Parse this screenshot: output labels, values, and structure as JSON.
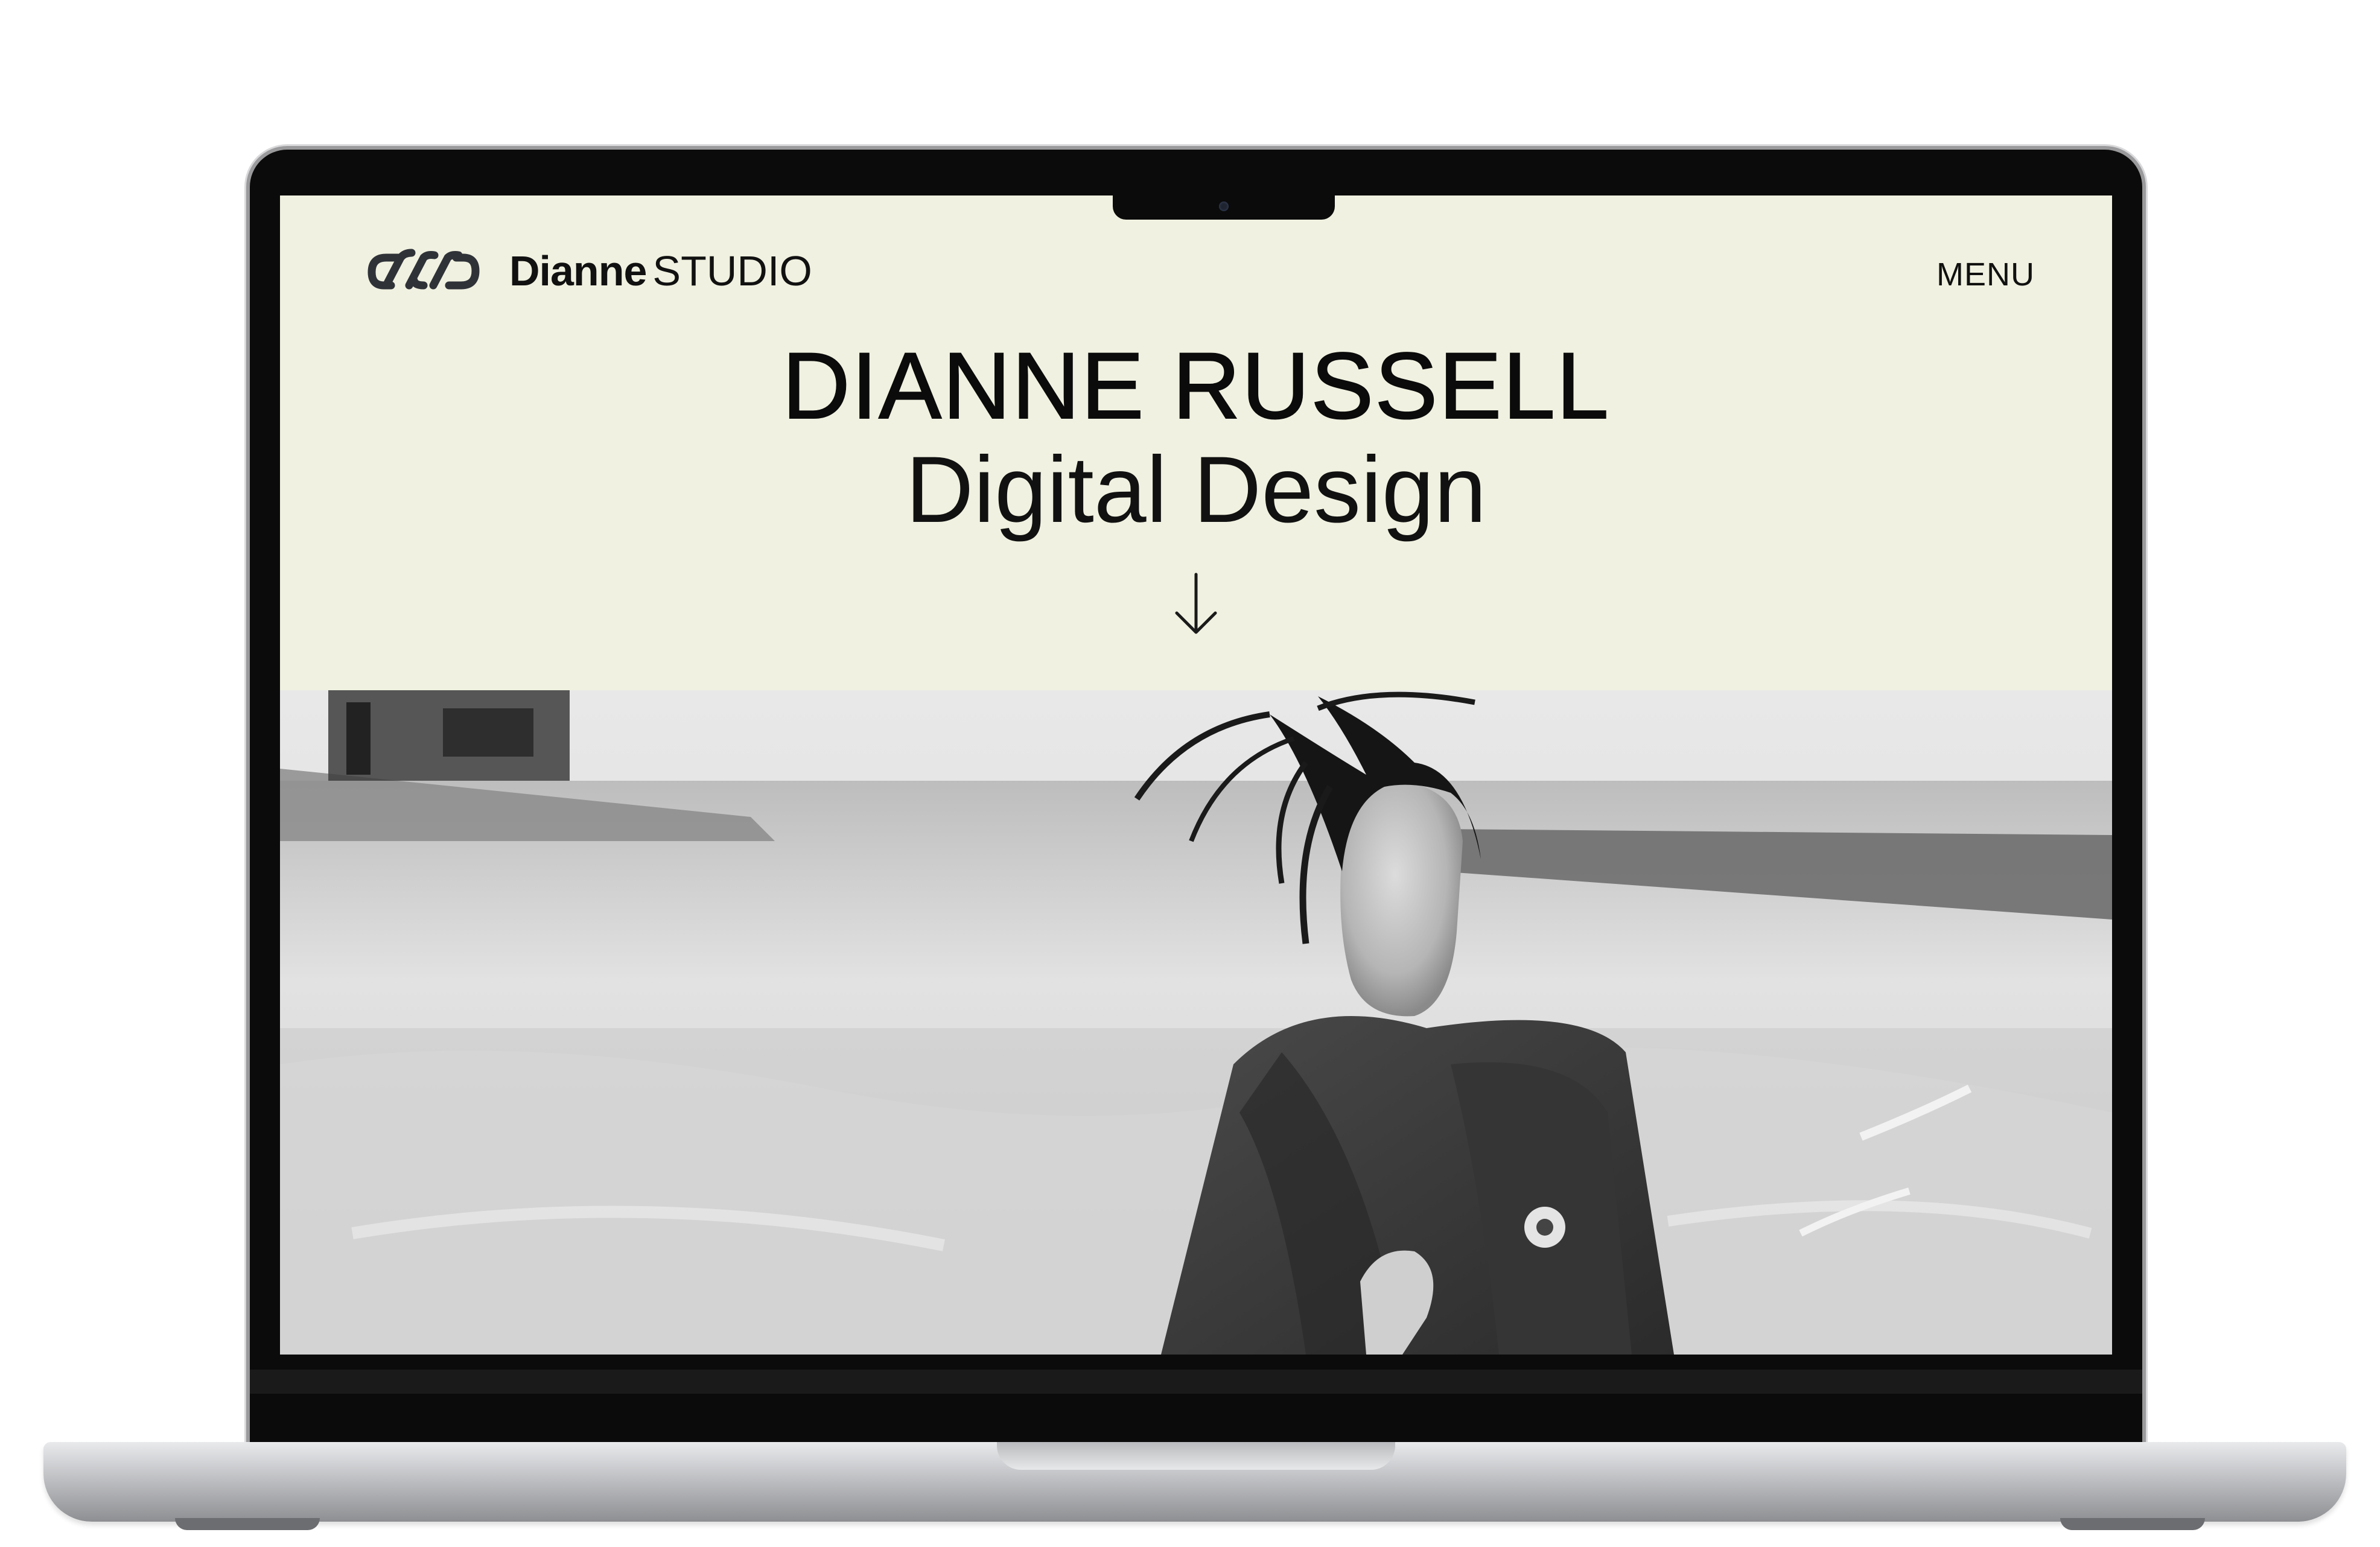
{
  "brand": {
    "name_bold": "Dianne",
    "name_light": "STUDIO",
    "logo_icon": "linked-loops-icon"
  },
  "nav": {
    "menu_label": "MENU"
  },
  "hero": {
    "title": "DIANNE RUSSELL",
    "subtitle": "Digital Design",
    "scroll_icon": "arrow-down-icon"
  },
  "photo": {
    "style": "black-and-white portrait"
  },
  "colors": {
    "page_background": "#f0f1e0",
    "text": "#111111",
    "bezel": "#0b0b0b",
    "aluminium": "#c9cacd"
  }
}
